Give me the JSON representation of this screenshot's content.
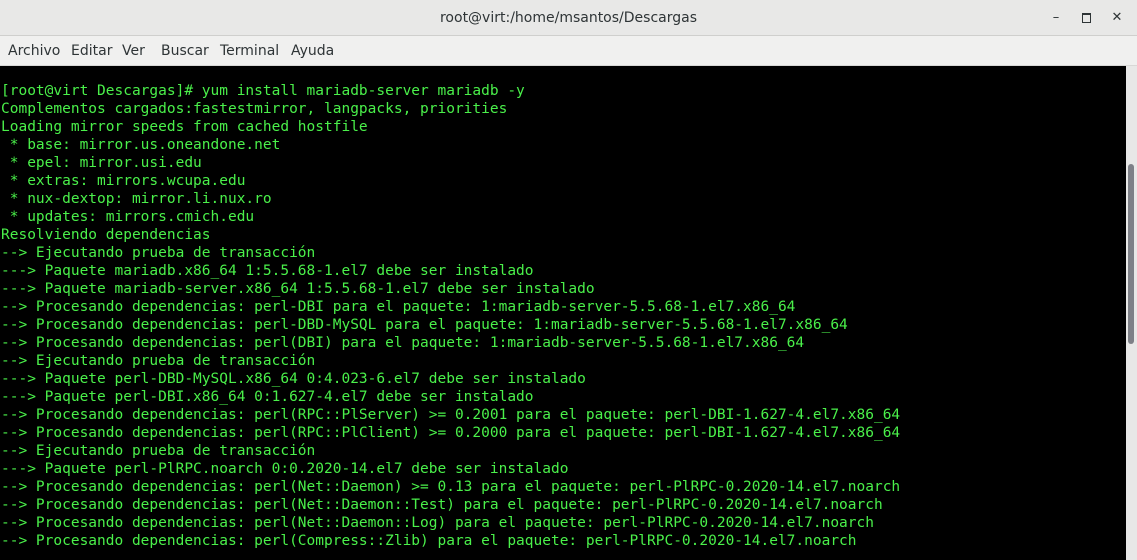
{
  "window": {
    "title": "root@virt:/home/msantos/Descargas",
    "minimize_icon": "minimize-icon",
    "maximize_icon": "maximize-icon",
    "close_icon": "close-icon",
    "minimize_glyph": "–",
    "close_glyph": "✕"
  },
  "menu": {
    "items": [
      "Archivo",
      "Editar",
      "Ver",
      "Buscar",
      "Terminal",
      "Ayuda"
    ]
  },
  "colors": {
    "terminal_bg": "#000000",
    "terminal_fg": "#4af04a",
    "chrome_bg": "#e8e8e7"
  },
  "terminal": {
    "lines": [
      "[root@virt Descargas]# yum install mariadb-server mariadb -y",
      "Complementos cargados:fastestmirror, langpacks, priorities",
      "Loading mirror speeds from cached hostfile",
      " * base: mirror.us.oneandone.net",
      " * epel: mirror.usi.edu",
      " * extras: mirrors.wcupa.edu",
      " * nux-dextop: mirror.li.nux.ro",
      " * updates: mirrors.cmich.edu",
      "Resolviendo dependencias",
      "--> Ejecutando prueba de transacción",
      "---> Paquete mariadb.x86_64 1:5.5.68-1.el7 debe ser instalado",
      "---> Paquete mariadb-server.x86_64 1:5.5.68-1.el7 debe ser instalado",
      "--> Procesando dependencias: perl-DBI para el paquete: 1:mariadb-server-5.5.68-1.el7.x86_64",
      "--> Procesando dependencias: perl-DBD-MySQL para el paquete: 1:mariadb-server-5.5.68-1.el7.x86_64",
      "--> Procesando dependencias: perl(DBI) para el paquete: 1:mariadb-server-5.5.68-1.el7.x86_64",
      "--> Ejecutando prueba de transacción",
      "---> Paquete perl-DBD-MySQL.x86_64 0:4.023-6.el7 debe ser instalado",
      "---> Paquete perl-DBI.x86_64 0:1.627-4.el7 debe ser instalado",
      "--> Procesando dependencias: perl(RPC::PlServer) >= 0.2001 para el paquete: perl-DBI-1.627-4.el7.x86_64",
      "--> Procesando dependencias: perl(RPC::PlClient) >= 0.2000 para el paquete: perl-DBI-1.627-4.el7.x86_64",
      "--> Ejecutando prueba de transacción",
      "---> Paquete perl-PlRPC.noarch 0:0.2020-14.el7 debe ser instalado",
      "--> Procesando dependencias: perl(Net::Daemon) >= 0.13 para el paquete: perl-PlRPC-0.2020-14.el7.noarch",
      "--> Procesando dependencias: perl(Net::Daemon::Test) para el paquete: perl-PlRPC-0.2020-14.el7.noarch",
      "--> Procesando dependencias: perl(Net::Daemon::Log) para el paquete: perl-PlRPC-0.2020-14.el7.noarch",
      "--> Procesando dependencias: perl(Compress::Zlib) para el paquete: perl-PlRPC-0.2020-14.el7.noarch"
    ]
  }
}
